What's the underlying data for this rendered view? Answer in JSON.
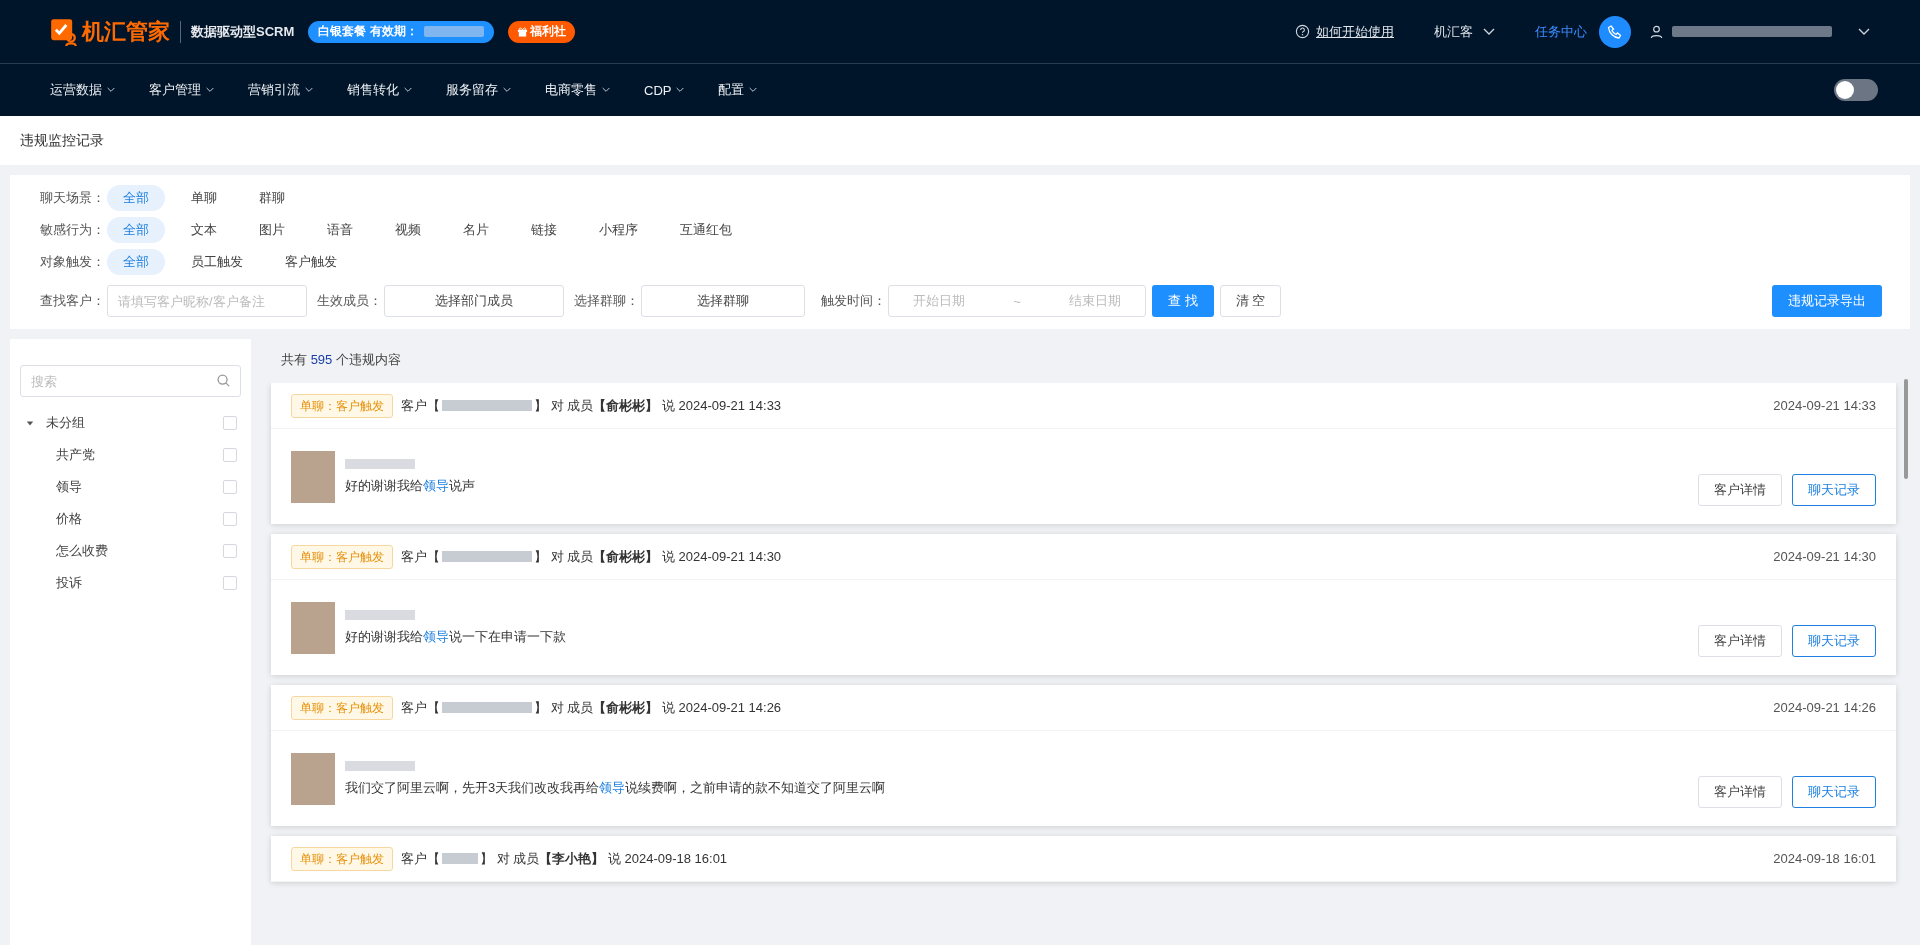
{
  "header": {
    "logo": "机汇管家",
    "tagline": "数据驱动型SCRM",
    "plan_badge": "白银套餐 有效期：",
    "welfare_badge": "福利社",
    "help_link": "如何开始使用",
    "org_menu": "机汇客",
    "task_center": "任务中心"
  },
  "nav": {
    "items": [
      "运营数据",
      "客户管理",
      "营销引流",
      "销售转化",
      "服务留存",
      "电商零售",
      "CDP",
      "配置"
    ],
    "toggle": {
      "on": false
    }
  },
  "page_title": "违规监控记录",
  "filters": {
    "groups": [
      {
        "label": "聊天场景：",
        "options": [
          {
            "label": "全部",
            "selected": true
          },
          {
            "label": "单聊",
            "selected": false
          },
          {
            "label": "群聊",
            "selected": false
          }
        ]
      },
      {
        "label": "敏感行为：",
        "options": [
          {
            "label": "全部",
            "selected": true
          },
          {
            "label": "文本",
            "selected": false
          },
          {
            "label": "图片",
            "selected": false
          },
          {
            "label": "语音",
            "selected": false
          },
          {
            "label": "视频",
            "selected": false
          },
          {
            "label": "名片",
            "selected": false
          },
          {
            "label": "链接",
            "selected": false
          },
          {
            "label": "小程序",
            "selected": false
          },
          {
            "label": "互通红包",
            "selected": false
          }
        ]
      },
      {
        "label": "对象触发：",
        "options": [
          {
            "label": "全部",
            "selected": true
          },
          {
            "label": "员工触发",
            "selected": false
          },
          {
            "label": "客户触发",
            "selected": false
          }
        ]
      }
    ],
    "customer_label": "查找客户：",
    "customer_placeholder": "请填写客户昵称/客户备注",
    "member_label": "生效成员：",
    "member_button": "选择部门成员",
    "group_label": "选择群聊：",
    "group_button": "选择群聊",
    "time_label": "触发时间：",
    "start_placeholder": "开始日期",
    "range_sep": "~",
    "end_placeholder": "结束日期",
    "search_button": "查 找",
    "clear_button": "清 空",
    "export_button": "违规记录导出"
  },
  "sidebar": {
    "search_placeholder": "搜索",
    "tree": [
      {
        "label": "未分组",
        "expanded": true,
        "checked": false,
        "children": [
          {
            "label": "共产党",
            "checked": false
          },
          {
            "label": "领导",
            "checked": false
          },
          {
            "label": "价格",
            "checked": false
          },
          {
            "label": "怎么收费",
            "checked": false
          },
          {
            "label": "投诉",
            "checked": false
          }
        ]
      }
    ]
  },
  "summary": {
    "prefix": "共有",
    "count": "595",
    "suffix": "个违规内容"
  },
  "records": [
    {
      "tag": "单聊：客户触发",
      "prefix": "客户【",
      "rest": "】 对 成员**【俞彬彬】** 说 2024-09-21 14:33",
      "time": "2024-09-21 14:33",
      "message": {
        "before": "好的谢谢我给",
        "keyword": "领导",
        "after": "说声"
      },
      "detail_button": "客户详情",
      "chat_button": "聊天记录"
    },
    {
      "tag": "单聊：客户触发",
      "prefix": "客户【",
      "rest": "】 对 成员**【俞彬彬】** 说 2024-09-21 14:30",
      "time": "2024-09-21 14:30",
      "message": {
        "before": "好的谢谢我给",
        "keyword": "领导",
        "after": "说一下在申请一下款"
      },
      "detail_button": "客户详情",
      "chat_button": "聊天记录"
    },
    {
      "tag": "单聊：客户触发",
      "prefix": "客户【",
      "rest": "】 对 成员**【俞彬彬】** 说 2024-09-21 14:26",
      "time": "2024-09-21 14:26",
      "message": {
        "before": "我们交了阿里云啊，先开3天我们改改我再给",
        "keyword": "领导",
        "after": "说续费啊，之前申请的款不知道交了阿里云啊"
      },
      "detail_button": "客户详情",
      "chat_button": "聊天记录"
    },
    {
      "tag": "单聊：客户触发",
      "prefix": "客户【",
      "rest": "】 对 成员**【李小艳】** 说 2024-09-18 16:01",
      "time": "2024-09-18 16:01"
    }
  ]
}
